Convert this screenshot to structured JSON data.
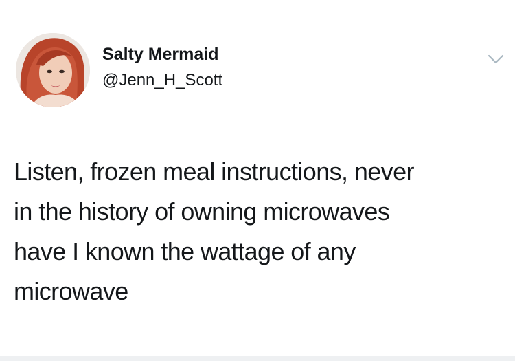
{
  "tweet": {
    "author": {
      "display_name": "Salty Mermaid",
      "handle": "@Jenn_H_Scott",
      "avatar_icon": "profile-photo"
    },
    "menu_icon": "chevron-down-icon",
    "text": "Listen, frozen meal instructions, never\nin the history of owning microwaves\nhave I known the wattage of any\nmicrowave"
  },
  "colors": {
    "text": "#14171a",
    "chevron": "#aab8c2",
    "background": "#ffffff"
  }
}
